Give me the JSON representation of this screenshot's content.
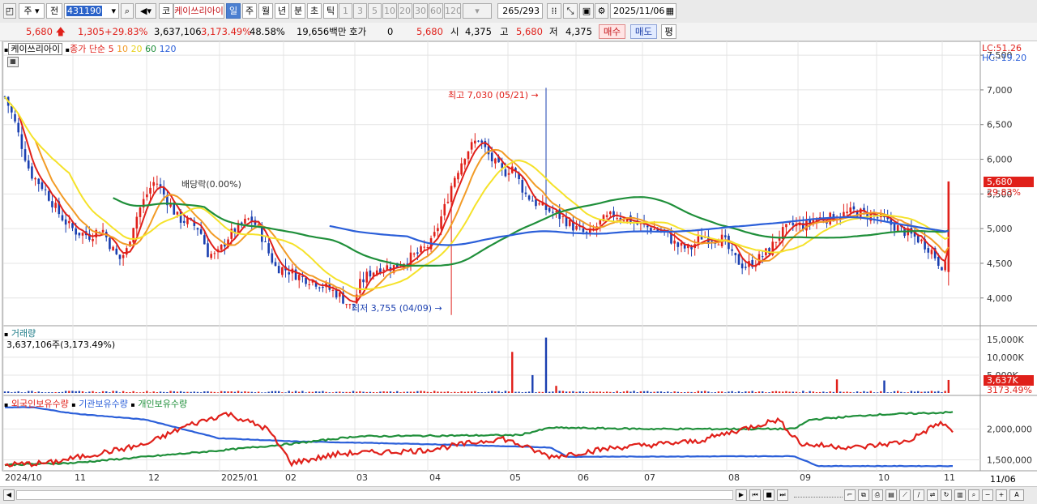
{
  "toolbar": {
    "period_button": "주",
    "prev_button": "전",
    "stock_code": "431190",
    "market_badge": "코",
    "stock_name": "케이쓰리아이",
    "period_tabs": [
      "일",
      "주",
      "월",
      "년",
      "분",
      "초",
      "틱"
    ],
    "period_selected": "일",
    "interval_tabs": [
      "1",
      "3",
      "5",
      "10",
      "20",
      "30",
      "60",
      "120"
    ],
    "count": "265",
    "total": "/293",
    "date": "2025/11/06"
  },
  "quote": {
    "price": "5,680",
    "change": "1,305",
    "change_pct": "+29.83%",
    "volume": "3,637,106",
    "volume_pct": "3,173.49%",
    "turnover_pct": "48.58%",
    "trade_value": "19,656백만",
    "ask_label": "호가",
    "ask_value": "0",
    "ask_price": "5,680",
    "open_label": "시",
    "open": "4,375",
    "high_label": "고",
    "high": "5,680",
    "low_label": "저",
    "low": "4,375",
    "buy_button": "매수",
    "sell_button": "매도",
    "eval_button": "평"
  },
  "price_panel": {
    "title": "케이쓰리아이",
    "ma_label": "종가 단순",
    "ma_periods": [
      "5",
      "10",
      "20",
      "60",
      "120"
    ],
    "ma_colors": [
      "#e0201a",
      "#f29b26",
      "#f5e22a",
      "#1f8f3a",
      "#2b5fd9"
    ],
    "lc_label": "LC:51.26",
    "hc_label": "HC:-19.20",
    "y_ticks": [
      "7,500",
      "7,000",
      "6,500",
      "6,000",
      "5,500",
      "5,000",
      "4,500",
      "4,000"
    ],
    "high_annotation": "최고 7,030 (05/21)",
    "low_annotation": "최저 3,755 (04/09)",
    "dividend_annotation": "배당락(0.00%)",
    "current_price_tag": "5,680",
    "current_pct_tag": "29.83%"
  },
  "volume_panel": {
    "title": "거래량",
    "value_line": "3,637,106주(3,173.49%)",
    "y_ticks": [
      "15,000K",
      "10,000K",
      "5,000K"
    ],
    "current_tag": "3,637K",
    "current_pct": "3173.49%"
  },
  "holding_panel": {
    "legend": [
      "외국인보유수량",
      "기관보유수량",
      "개인보유수량"
    ],
    "legend_colors": [
      "#e0201a",
      "#2b5fd9",
      "#1f8f3a"
    ],
    "y_ticks": [
      "2,000,000",
      "1,500,000"
    ]
  },
  "x_axis": {
    "labels": [
      "2024/10",
      "11",
      "12",
      "2025/01",
      "02",
      "03",
      "04",
      "05",
      "06",
      "07",
      "08",
      "09",
      "10",
      "11"
    ],
    "right_label": "11/06"
  },
  "chart_data": {
    "type": "candlestick",
    "price_range": [
      3600,
      7700
    ],
    "annotations": {
      "high": 7030,
      "high_date": "05/21",
      "low": 3755,
      "low_date": "04/09"
    },
    "last_close": 5680,
    "series": [
      {
        "name": "5",
        "color": "#e0201a"
      },
      {
        "name": "10",
        "color": "#f29b26"
      },
      {
        "name": "20",
        "color": "#f5e22a"
      },
      {
        "name": "60",
        "color": "#1f8f3a"
      },
      {
        "name": "120",
        "color": "#2b5fd9"
      }
    ]
  }
}
